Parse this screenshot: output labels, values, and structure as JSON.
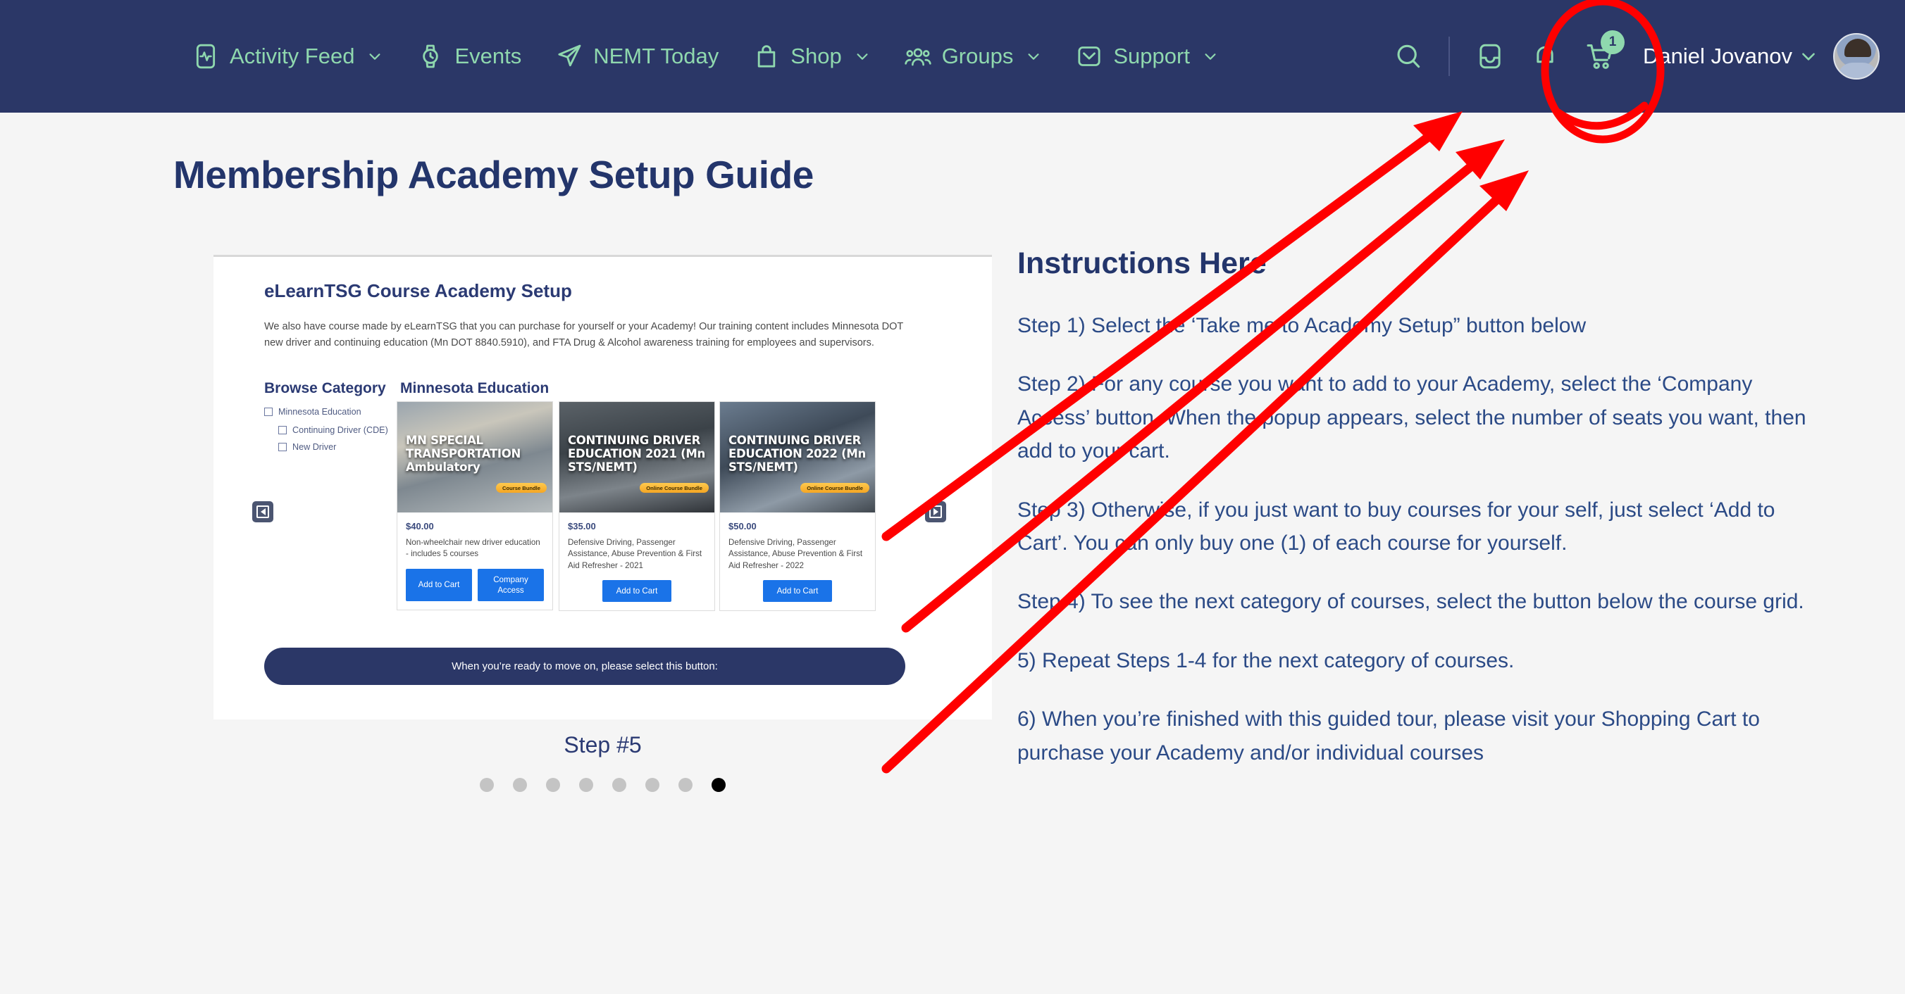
{
  "nav": {
    "items": [
      {
        "label": "Activity Feed",
        "icon": "activity-feed-icon",
        "caret": true
      },
      {
        "label": "Events",
        "icon": "watch-clock-icon",
        "caret": false
      },
      {
        "label": "NEMT Today",
        "icon": "paper-plane-icon",
        "caret": false
      },
      {
        "label": "Shop",
        "icon": "shopping-bag-icon",
        "caret": true
      },
      {
        "label": "Groups",
        "icon": "people-group-icon",
        "caret": true
      },
      {
        "label": "Support",
        "icon": "envelope-icon",
        "caret": true
      }
    ],
    "right": {
      "search_icon": "search-icon",
      "inbox_icon": "inbox-icon",
      "bell_icon": "notifications-bell-icon",
      "cart_icon": "shopping-cart-icon",
      "cart_badge": "1",
      "username": "Daniel Jovanov",
      "avatar": "user-avatar"
    },
    "colors": {
      "background": "#2b3767",
      "accent": "#8fd8ae",
      "username": "#ffffff"
    }
  },
  "page": {
    "title": "Membership Academy Setup Guide",
    "title_color": "#23356b",
    "background": "#f5f5f5"
  },
  "screenshot": {
    "title": "eLearnTSG Course Academy Setup",
    "paragraph": "We also have course made by eLearnTSG that you can purchase for yourself or your Academy! Our training content includes Minnesota DOT new driver and continuing education (Mn DOT 8840.5910), and FTA Drug & Alcohol awareness training for employees and supervisors.",
    "browse_heading": "Browse Category",
    "categories": [
      {
        "label": "Minnesota Education",
        "checked": false
      },
      {
        "label": "Continuing Driver (CDE)",
        "checked": false
      },
      {
        "label": "New Driver",
        "checked": false
      }
    ],
    "grid_heading": "Minnesota Education",
    "prev_icon": "carousel-prev-arrow-icon",
    "next_icon": "carousel-next-arrow-icon",
    "cards": [
      {
        "image_title": "MN SPECIAL TRANSPORTATION Ambulatory",
        "bundle_tag": "Course Bundle",
        "price": "$40.00",
        "description": "Non-wheelchair new driver education - includes 5 courses",
        "buttons": [
          "Add to Cart",
          "Company Access"
        ]
      },
      {
        "image_title": "CONTINUING DRIVER EDUCATION 2021 (Mn STS/NEMT)",
        "bundle_tag": "Online Course Bundle",
        "price": "$35.00",
        "description": "Defensive Driving, Passenger Assistance, Abuse Prevention & First Aid Refresher - 2021",
        "buttons": [
          "Add to Cart"
        ]
      },
      {
        "image_title": "CONTINUING DRIVER EDUCATION 2022 (Mn STS/NEMT)",
        "bundle_tag": "Online Course Bundle",
        "price": "$50.00",
        "description": "Defensive Driving, Passenger Assistance, Abuse Prevention & First Aid Refresher - 2022",
        "buttons": [
          "Add to Cart"
        ]
      }
    ],
    "move_on_button": "When you’re ready to move on, please select this button:"
  },
  "carousel": {
    "step_caption": "Step #5",
    "total_dots": 8,
    "active_dot_index": 7
  },
  "instructions": {
    "title": "Instructions Here",
    "paragraphs": [
      "Step 1) Select the ‘Take me to Academy Setup” button below",
      "Step 2) For any course you want to add to your Academy, select the ‘Company Access’ button. When the popup appears, select the number of seats you want, then add to your cart.",
      "Step 3) Otherwise, if you just want to buy courses for your self, just select ‘Add to Cart’. You can only buy one (1) of each course for yourself.",
      "Step 4) To see the next category of courses, select the button below the course grid.",
      "5) Repeat Steps 1-4 for the next category of courses.",
      "6) When you’re finished with this guided tour, please visit your Shopping Cart to purchase your Academy and/or individual courses"
    ]
  },
  "annotations": {
    "color": "#ff0000",
    "circle_target": "shopping-cart-icon",
    "arrow_count": 3
  }
}
